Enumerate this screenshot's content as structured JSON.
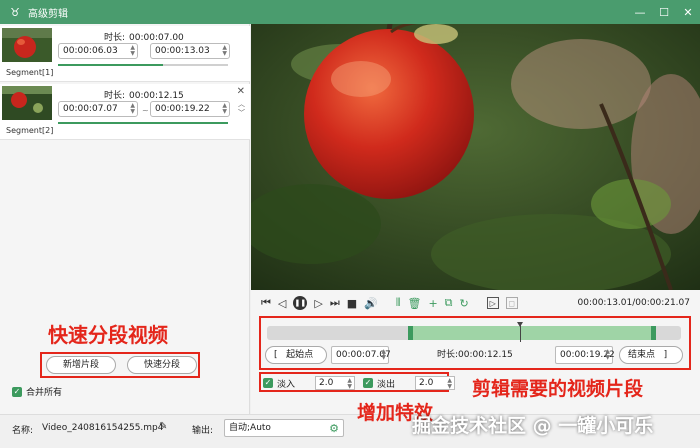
{
  "window": {
    "title": "高级剪辑",
    "minimize_icon": "minimize-icon",
    "maximize_icon": "maximize-icon",
    "close_icon": "close-icon"
  },
  "segments": [
    {
      "label": "Segment[1]",
      "duration_label": "时长:",
      "duration": "00:00:07.00",
      "start": "00:00:06.03",
      "end": "00:00:13.03",
      "progress_start": 0.0,
      "progress_end": 0.62
    },
    {
      "label": "Segment[2]",
      "duration_label": "时长:",
      "duration": "00:00:12.15",
      "start": "00:00:07.07",
      "separator": "~",
      "end": "00:00:19.22",
      "progress_start": 0.0,
      "progress_end": 1.0
    }
  ],
  "annotations": {
    "quick_split": "快速分段视频",
    "trim_clip": "剪辑需要的视频片段",
    "add_effects": "增加特效"
  },
  "left_actions": {
    "add_segment": "新增片段",
    "quick_split": "快速分段"
  },
  "merge_all": {
    "checked": true,
    "label": "合并所有"
  },
  "footer": {
    "name_label": "名称:",
    "name_value": "Video_240816154255.mp4",
    "output_label": "输出:",
    "output_value": "自动;Auto"
  },
  "watermark": "掘金技术社区 @ 一罐小可乐",
  "player": {
    "timecode": "00:00:13.01/00:00:21.07",
    "selection_start": 0.34,
    "selection_end": 0.94,
    "playhead": 0.61
  },
  "trim": {
    "start_button": "起始点",
    "start_time": "00:00:07.07",
    "duration_label": "时长:",
    "duration": "00:00:12.15",
    "end_time": "00:00:19.22",
    "end_button": "结束点"
  },
  "effects": {
    "fade_in": {
      "checked": true,
      "label": "淡入",
      "value": "2.0"
    },
    "fade_out": {
      "checked": true,
      "label": "淡出",
      "value": "2.0"
    }
  },
  "colors": {
    "accent": "#4a9c6e",
    "annotation": "#e4261b",
    "selection": "#9fd4a6"
  }
}
